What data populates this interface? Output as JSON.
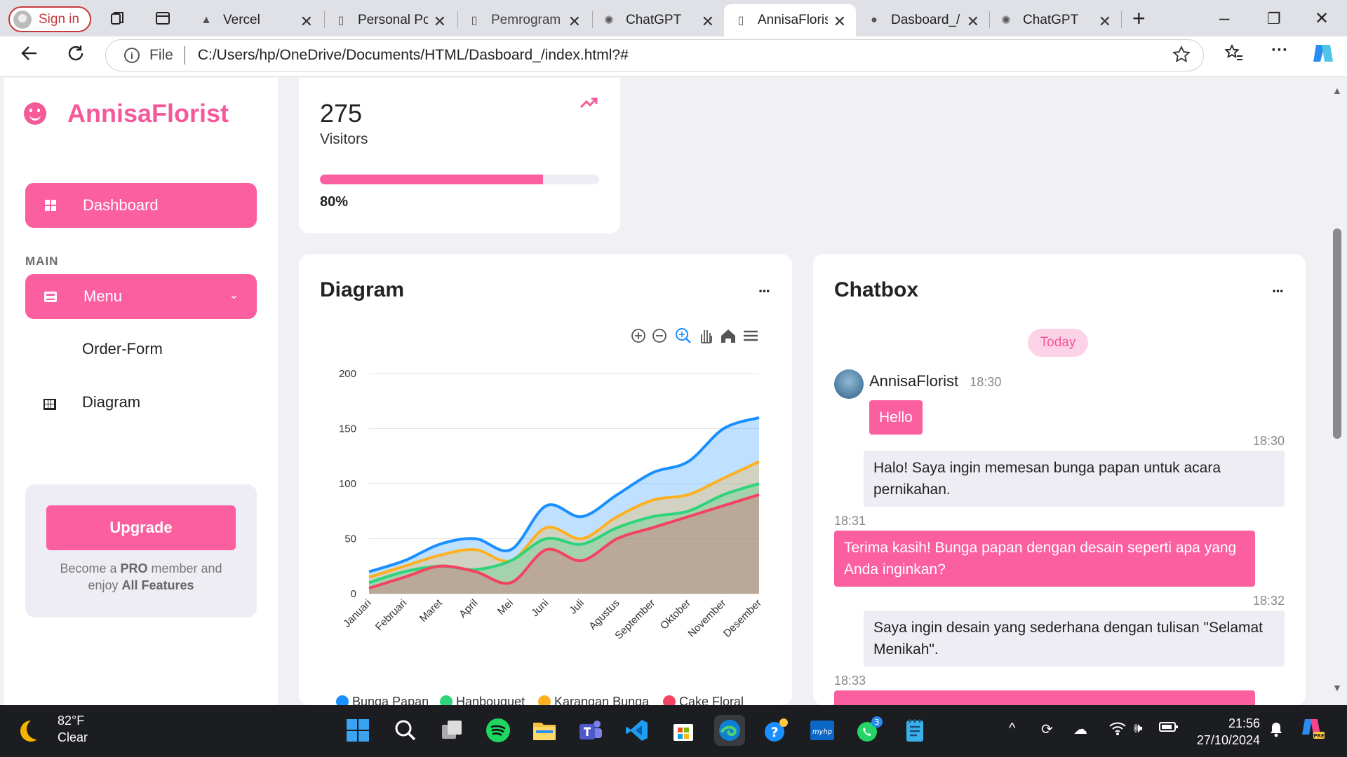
{
  "browser": {
    "signin": "Sign in",
    "tabs": [
      {
        "title": "Vercel"
      },
      {
        "title": "Personal Por"
      },
      {
        "title": "Pemrograma"
      },
      {
        "title": "ChatGPT"
      },
      {
        "title": "AnnisaFlorist"
      },
      {
        "title": "Dasboard_/"
      },
      {
        "title": "ChatGPT"
      }
    ],
    "file_label": "File",
    "url": "C:/Users/hp/OneDrive/Documents/HTML/Dasboard_/index.html?#"
  },
  "sidebar": {
    "brand": "AnnisaFlorist",
    "dashboard": "Dashboard",
    "section": "MAIN",
    "menu": "Menu",
    "order_form": "Order-Form",
    "diagram": "Diagram",
    "upgrade": {
      "button": "Upgrade",
      "line1_a": "Become a ",
      "pro": "PRO",
      "line1_b": " member and",
      "line2_a": "enjoy ",
      "features": "All Features"
    }
  },
  "visitors": {
    "count": "275",
    "label": "Visitors",
    "percent_label": "80%",
    "progress": 0.8,
    "trend_icon": "trending-up-icon"
  },
  "diagram": {
    "title": "Diagram",
    "more": "···"
  },
  "chart_data": {
    "type": "area",
    "categories": [
      "Januari",
      "Februari",
      "Maret",
      "April",
      "Mei",
      "Juni",
      "Juli",
      "Agustus",
      "September",
      "Oktober",
      "November",
      "Desember"
    ],
    "ylim": [
      0,
      200
    ],
    "yticks": [
      "0",
      "50",
      "100",
      "150",
      "200"
    ],
    "series": [
      {
        "name": "Bunga Papan",
        "color": "#1a8fff",
        "values": [
          20,
          30,
          45,
          50,
          40,
          80,
          70,
          90,
          110,
          120,
          150,
          160
        ]
      },
      {
        "name": "Hanbouquet",
        "color": "#2ed47a",
        "values": [
          10,
          20,
          25,
          22,
          30,
          50,
          45,
          60,
          70,
          75,
          90,
          100
        ]
      },
      {
        "name": "Karangan Bunga",
        "color": "#ffb020",
        "values": [
          15,
          25,
          35,
          40,
          30,
          60,
          50,
          70,
          85,
          90,
          105,
          120
        ]
      },
      {
        "name": "Cake Floral",
        "color": "#f44260",
        "values": [
          5,
          15,
          25,
          20,
          10,
          40,
          30,
          50,
          60,
          70,
          80,
          90
        ]
      }
    ],
    "legend": "bottom"
  },
  "chat": {
    "title": "Chatbox",
    "more": "···",
    "today": "Today",
    "sender": "AnnisaFlorist",
    "sender_time": "18:30",
    "messages": [
      {
        "text": "Hello"
      },
      {
        "time": "18:30",
        "text": "Halo! Saya ingin memesan bunga papan untuk acara pernikahan."
      },
      {
        "time": "18:31",
        "text": "Terima kasih! Bunga papan dengan desain seperti apa yang Anda inginkan?"
      },
      {
        "time": "18:32",
        "text": "Saya ingin desain yang sederhana dengan tulisan \"Selamat Menikah\"."
      },
      {
        "time": "18:33",
        "text": ""
      }
    ]
  },
  "taskbar": {
    "temp": "82°F",
    "cond": "Clear",
    "time": "21:56",
    "date": "27/10/2024",
    "whatsapp_badge": "3"
  }
}
